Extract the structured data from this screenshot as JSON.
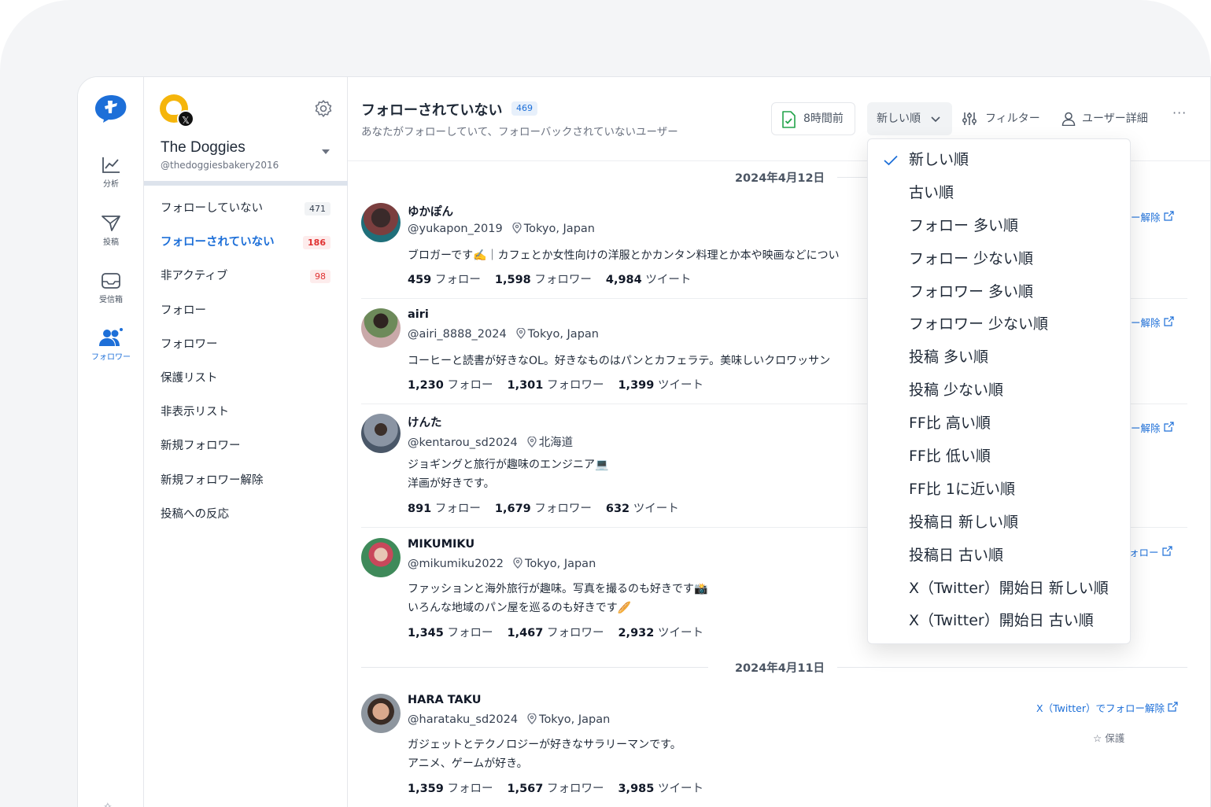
{
  "rail": {
    "items": [
      {
        "label": "分析",
        "icon": "chart-line-icon"
      },
      {
        "label": "投稿",
        "icon": "paper-plane-icon"
      },
      {
        "label": "受信箱",
        "icon": "inbox-icon"
      },
      {
        "label": "フォロワー",
        "icon": "users-icon"
      }
    ]
  },
  "account": {
    "name": "The Doggies",
    "handle": "@thedoggiesbakery2016",
    "badge_glyph": "𝕏"
  },
  "sidebar": {
    "items": [
      {
        "label": "フォローしていない",
        "count": "471"
      },
      {
        "label": "フォローされていない",
        "count": "186"
      },
      {
        "label": "非アクティブ",
        "count": "98"
      },
      {
        "label": "フォロー",
        "count": ""
      },
      {
        "label": "フォロワー",
        "count": ""
      },
      {
        "label": "保護リスト",
        "count": ""
      },
      {
        "label": "非表示リスト",
        "count": ""
      },
      {
        "label": "新規フォロワー",
        "count": ""
      },
      {
        "label": "新規フォロワー解除",
        "count": ""
      },
      {
        "label": "投稿への反応",
        "count": ""
      }
    ]
  },
  "header": {
    "title": "フォローされていない",
    "count": "469",
    "subtitle": "あなたがフォローしていて、フォローバックされていないユーザー",
    "sync_label": "8時間前",
    "sort_label": "新しい順",
    "filter_label": "フィルター",
    "user_detail_label": "ユーザー詳細",
    "more_label": "···"
  },
  "dates": {
    "d1": "2024年4月12日",
    "d2": "2024年4月11日"
  },
  "users": [
    {
      "name": "ゆかぽん",
      "handle": "@yukapon_2019",
      "location": "Tokyo, Japan",
      "bio": [
        "ブロガーです✍️｜カフェとか女性向けの洋服とかカンタン料理とか本や映画などについ"
      ],
      "following": "459",
      "following_label": "フォロー",
      "followers": "1,598",
      "followers_label": "フォロワー",
      "tweets": "4,984",
      "tweets_label": "ツイート",
      "unfollow": "ー解除"
    },
    {
      "name": "airi",
      "handle": "@airi_8888_2024",
      "location": "Tokyo, Japan",
      "bio": [
        " コーヒーと読書が好きなOL。好きなものはパンとカフェラテ。美味しいクロワッサン"
      ],
      "following": "1,230",
      "following_label": "フォロー",
      "followers": "1,301",
      "followers_label": "フォロワー",
      "tweets": "1,399",
      "tweets_label": "ツイート",
      "unfollow": "ー解除"
    },
    {
      "name": "けんた",
      "handle": "@kentarou_sd2024",
      "location": "北海道",
      "bio": [
        "ジョギングと旅行が趣味のエンジニア💻",
        "洋画が好きです。"
      ],
      "following": "891",
      "following_label": "フォロー",
      "followers": "1,679",
      "followers_label": "フォロワー",
      "tweets": "632",
      "tweets_label": "ツイート",
      "unfollow": "ー解除"
    },
    {
      "name": "MIKUMIKU",
      "handle": "@mikumiku2022",
      "location": "Tokyo, Japan",
      "bio": [
        "ファッションと海外旅行が趣味。写真を撮るのも好きです📸",
        "いろんな地域のパン屋を巡るのも好きです🥖"
      ],
      "following": "1,345",
      "following_label": "フォロー",
      "followers": "1,467",
      "followers_label": "フォロワー",
      "tweets": "2,932",
      "tweets_label": "ツイート",
      "unfollow": "ォロー"
    },
    {
      "name": "HARA TAKU",
      "handle": "@harataku_sd2024",
      "location": "Tokyo, Japan",
      "bio": [
        "ガジェットとテクノロジーが好きなサラリーマンです。",
        "アニメ、ゲームが好き。"
      ],
      "following": "1,359",
      "following_label": "フォロー",
      "followers": "1,567",
      "followers_label": "フォロワー",
      "tweets": "3,985",
      "tweets_label": "ツイート",
      "unfollow": "X（Twitter）でフォロー解除",
      "protect": "保護"
    }
  ],
  "sort_menu": {
    "selected_index": 0,
    "options": [
      "新しい順",
      "古い順",
      "フォロー 多い順",
      "フォロー 少ない順",
      "フォロワー 多い順",
      "フォロワー 少ない順",
      "投稿 多い順",
      "投稿 少ない順",
      "FF比 高い順",
      "FF比 低い順",
      "FF比 1に近い順",
      "投稿日 新しい順",
      "投稿日 古い順",
      "X（Twitter）開始日 新しい順",
      "X（Twitter）開始日 古い順"
    ]
  },
  "colors": {
    "accent": "#1d6fd8",
    "badge_red": "#e03131"
  }
}
